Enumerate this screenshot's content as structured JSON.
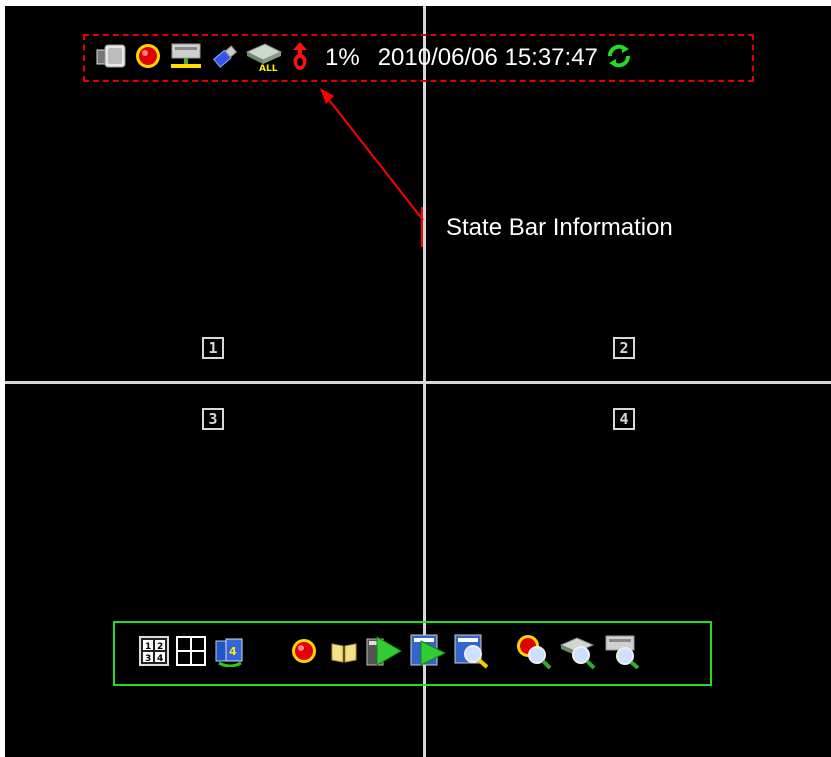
{
  "state_bar": {
    "percent": "1%",
    "datetime": "2010/06/06 15:37:47",
    "icons": [
      "camera-icon",
      "record-icon",
      "network-icon",
      "usb-icon",
      "hdd-all-icon",
      "alarm-icon",
      "refresh-icon"
    ]
  },
  "annotation": {
    "label": "State Bar Information"
  },
  "channels": [
    "1",
    "2",
    "3",
    "4"
  ],
  "toolbar": {
    "icons": [
      "split-4-numbered-icon",
      "split-4-icon",
      "sequence-icon",
      "record-icon",
      "log-book-icon",
      "playback-icon",
      "playback-list-icon",
      "search-icon",
      "record-search-icon",
      "hdd-search-icon",
      "event-search-icon"
    ]
  },
  "colors": {
    "annotation_red": "#ff0000",
    "toolbar_green": "#22dd22",
    "background": "#000000"
  }
}
